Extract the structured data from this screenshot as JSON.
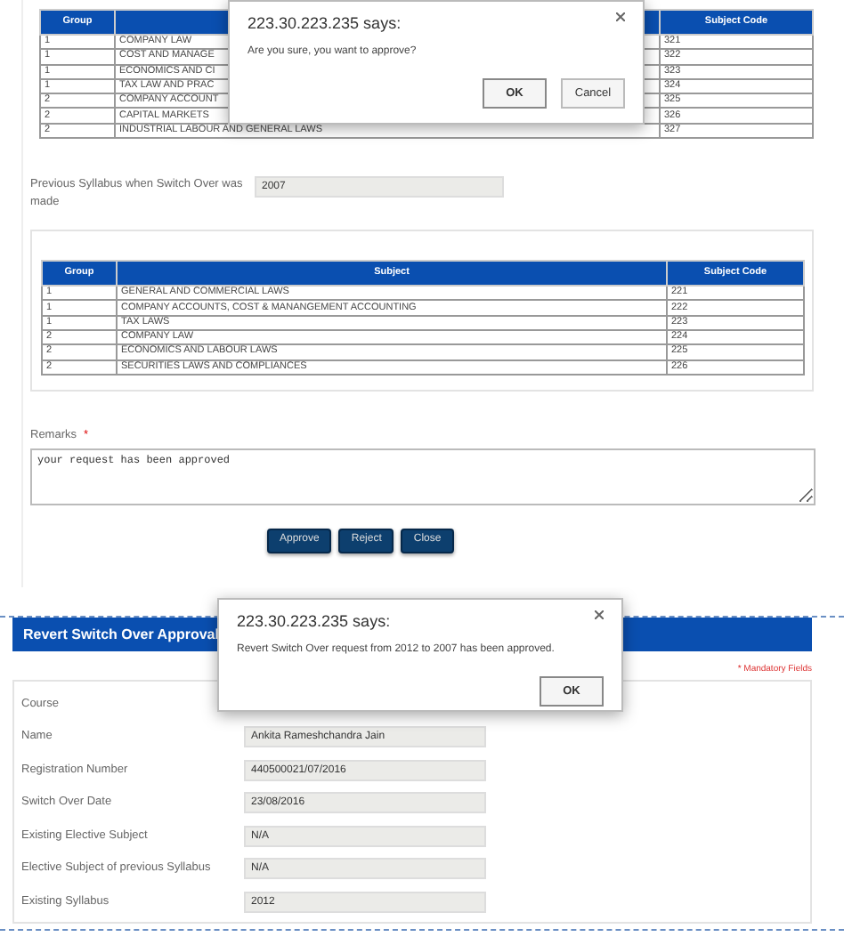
{
  "approval_screen": {
    "subjects_table": {
      "columns": [
        "Group",
        "Subject Code"
      ],
      "rows": [
        {
          "group": "1",
          "subject": "COMPANY LAW",
          "code": "321"
        },
        {
          "group": "1",
          "subject": "COST AND MANAGE",
          "code": "322"
        },
        {
          "group": "1",
          "subject": "ECONOMICS AND CI",
          "code": "323"
        },
        {
          "group": "1",
          "subject": "TAX LAW AND PRAC",
          "code": "324"
        },
        {
          "group": "2",
          "subject": "COMPANY ACCOUNT",
          "code": "325"
        },
        {
          "group": "2",
          "subject": "CAPITAL MARKETS",
          "code": "326"
        },
        {
          "group": "2",
          "subject": "INDUSTRIAL LABOUR AND GENERAL LAWS",
          "code": "327"
        }
      ]
    },
    "confirm_dialog": {
      "title": "223.30.223.235 says:",
      "message": "Are you sure, you want to approve?",
      "buttons": [
        "OK",
        "Cancel"
      ]
    },
    "previous_syllabus": {
      "label": "Previous Syllabus when Switch Over was made",
      "value": "2007"
    },
    "previous_subjects_table": {
      "columns": [
        "Group",
        "Subject",
        "Subject Code"
      ],
      "rows": [
        {
          "group": "1",
          "subject": "GENERAL AND COMMERCIAL LAWS",
          "code": "221"
        },
        {
          "group": "1",
          "subject": "COMPANY ACCOUNTS, COST & MANANGEMENT ACCOUNTING",
          "code": "222"
        },
        {
          "group": "1",
          "subject": "TAX LAWS",
          "code": "223"
        },
        {
          "group": "2",
          "subject": "COMPANY LAW",
          "code": "224"
        },
        {
          "group": "2",
          "subject": "ECONOMICS AND LABOUR LAWS",
          "code": "225"
        },
        {
          "group": "2",
          "subject": "SECURITIES LAWS AND COMPLIANCES",
          "code": "226"
        }
      ]
    },
    "remarks": {
      "label": "Remarks",
      "required_marker": "*",
      "value": "your request has been approved"
    },
    "buttons": [
      "Approve",
      "Reject",
      "Close"
    ]
  },
  "result_screen": {
    "title": "Revert Switch Over Approval",
    "mandatory_note": "* Mandatory Fields",
    "alert_dialog": {
      "title": "223.30.223.235 says:",
      "message": "Revert Switch Over request from 2012 to 2007 has been approved.",
      "buttons": [
        "OK"
      ]
    },
    "fields": [
      {
        "label": "Course"
      },
      {
        "label": "Name",
        "value": "Ankita Rameshchandra Jain"
      },
      {
        "label": "Registration Number",
        "value": "440500021/07/2016"
      },
      {
        "label": "Switch Over Date",
        "value": "23/08/2016"
      },
      {
        "label": "Existing Elective Subject",
        "value": "N/A"
      },
      {
        "label": "Elective Subject of previous Syllabus",
        "value": "N/A"
      },
      {
        "label": "Existing Syllabus",
        "value": "2012"
      }
    ]
  }
}
